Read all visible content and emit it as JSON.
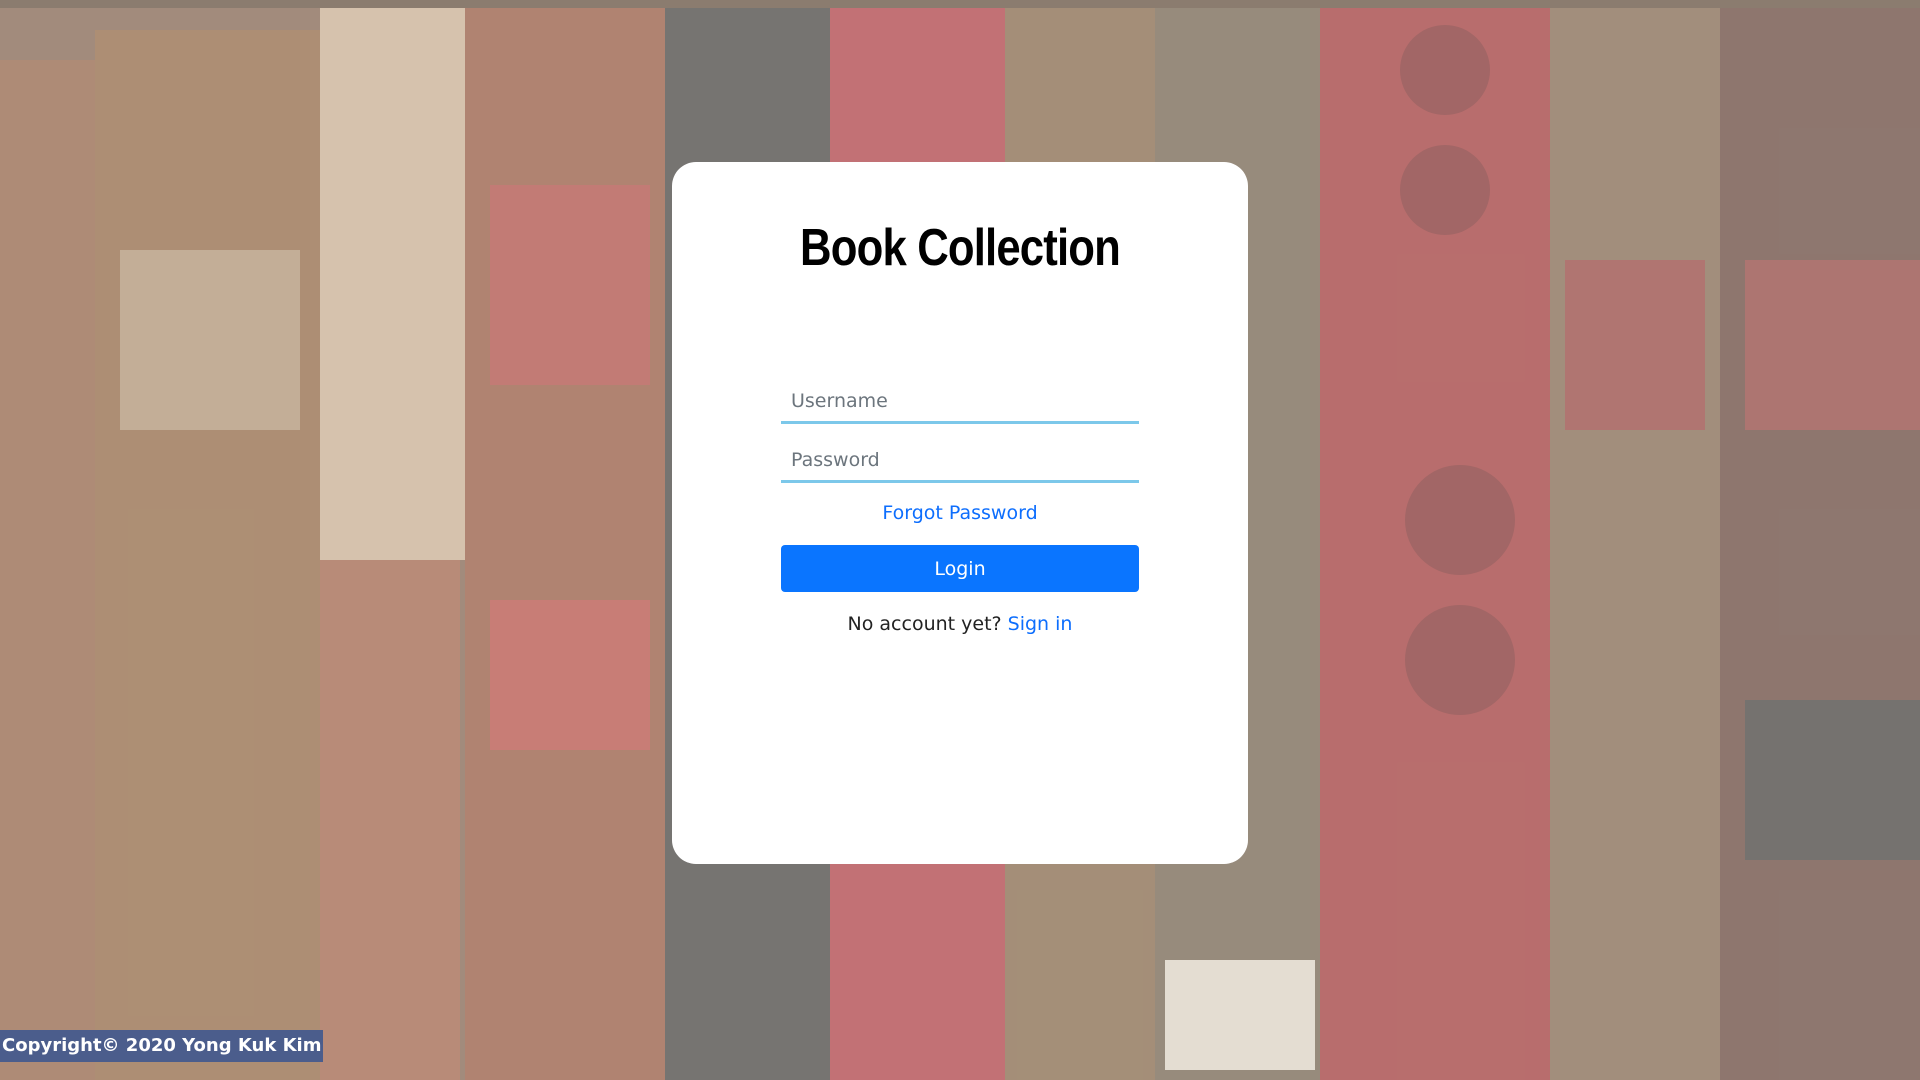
{
  "app": {
    "title": "Book Collection"
  },
  "login_form": {
    "username_placeholder": "Username",
    "password_placeholder": "Password",
    "forgot_password_label": "Forgot Password",
    "login_label": "Login",
    "no_account_text": "No account yet?",
    "sign_in_label": "Sign in"
  },
  "footer": {
    "copyright": "Copyright© 2020 Yong Kuk Kim"
  },
  "colors": {
    "primary": "#0a75ff",
    "link": "#0d6efd",
    "input_underline": "#7cc8ea",
    "footer_bg": "#4b5d8c"
  },
  "background": {
    "description_icon": "antique-book-spines-image"
  }
}
